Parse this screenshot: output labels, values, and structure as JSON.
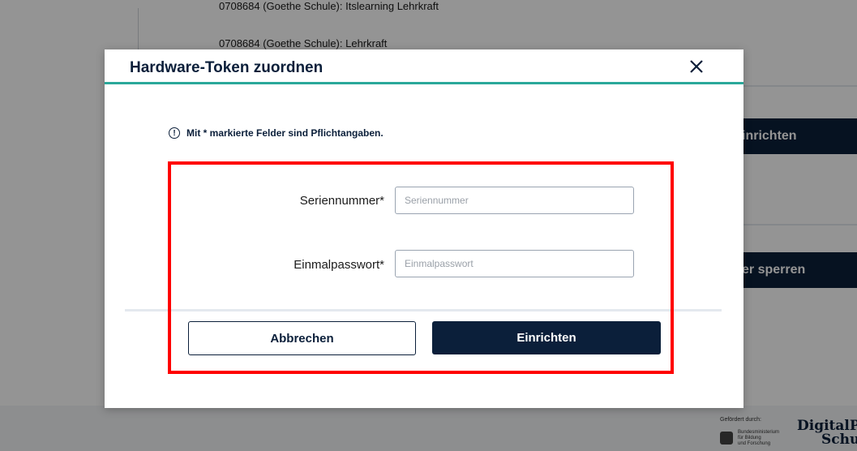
{
  "background": {
    "rows": [
      "0708684 (Goethe Schule): Itslearning Lehrkraft",
      "0708684 (Goethe Schule): Lehrkraft"
    ],
    "button_setup_label": "inrichten",
    "button_lock_label": "er sperren",
    "footer": {
      "funded_by": "Gefördert durch:",
      "ministry_lines": [
        "Bundesministerium",
        "für Bildung",
        "und Forschung"
      ],
      "brand_line1": "DigitalPal",
      "brand_line2": "Schu"
    }
  },
  "modal": {
    "title": "Hardware-Token zuordnen",
    "close_icon": "close-icon",
    "info_text": "Mit * markierte Felder sind Pflichtangaben.",
    "info_icon_glyph": "!",
    "fields": [
      {
        "label": "Seriennummer*",
        "placeholder": "Seriennummer",
        "value": ""
      },
      {
        "label": "Einmalpasswort*",
        "placeholder": "Einmalpasswort",
        "value": ""
      }
    ],
    "cancel_label": "Abbrechen",
    "submit_label": "Einrichten"
  },
  "colors": {
    "primary": "#0b1f3a",
    "accent": "#2aa89a",
    "highlight": "#ff0000"
  }
}
